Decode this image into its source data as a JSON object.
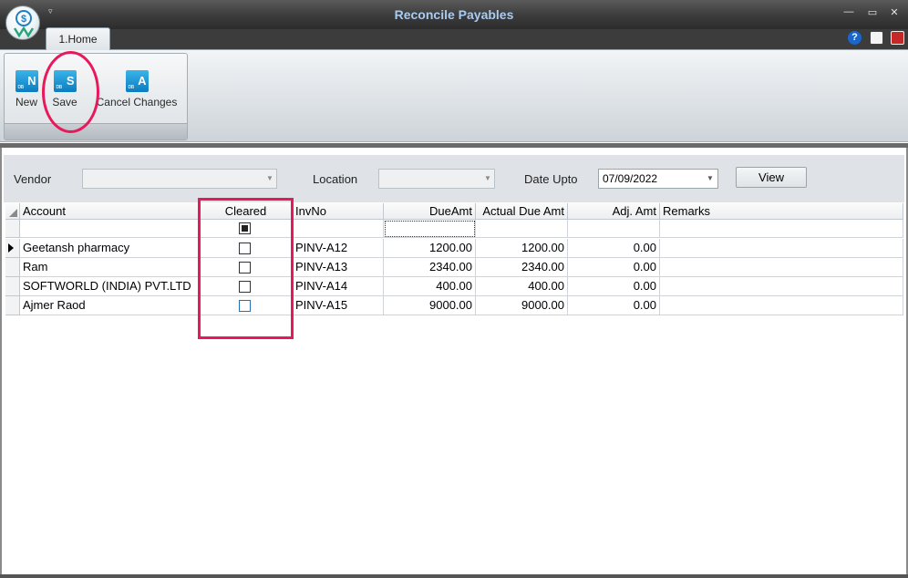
{
  "window": {
    "title": "Reconcile Payables",
    "qat_glyph": "▿",
    "minimize_glyph": "—",
    "maximize_glyph": "▭",
    "close_glyph": "✕"
  },
  "ribbon": {
    "tab_label": "1.Home",
    "buttons": {
      "new": {
        "label": "New",
        "icon_letter": "N"
      },
      "save": {
        "label": "Save",
        "icon_letter": "S"
      },
      "cancel": {
        "label": "Cancel Changes",
        "icon_letter": "A"
      }
    },
    "help_icon": "?"
  },
  "filters": {
    "vendor_label": "Vendor",
    "vendor_value": "",
    "location_label": "Location",
    "location_value": "",
    "date_label": "Date Upto",
    "date_value": "07/09/2022",
    "view_label": "View"
  },
  "grid": {
    "columns": {
      "account": "Account",
      "cleared": "Cleared",
      "invno": "InvNo",
      "dueamt": "DueAmt",
      "actual": "Actual Due Amt",
      "adj": "Adj. Amt",
      "remarks": "Remarks"
    },
    "rows": [
      {
        "account": "Geetansh pharmacy",
        "cleared": false,
        "invno": "PINV-A12",
        "dueamt": "1200.00",
        "actual": "1200.00",
        "adj": "0.00",
        "remarks": ""
      },
      {
        "account": "Ram",
        "cleared": false,
        "invno": "PINV-A13",
        "dueamt": "2340.00",
        "actual": "2340.00",
        "adj": "0.00",
        "remarks": ""
      },
      {
        "account": "SOFTWORLD (INDIA) PVT.LTD",
        "cleared": false,
        "invno": "PINV-A14",
        "dueamt": "400.00",
        "actual": "400.00",
        "adj": "0.00",
        "remarks": ""
      },
      {
        "account": "Ajmer Raod",
        "cleared": false,
        "invno": "PINV-A15",
        "dueamt": "9000.00",
        "actual": "9000.00",
        "adj": "0.00",
        "remarks": ""
      }
    ]
  },
  "colors": {
    "title_text": "#aacbf0",
    "annotation": "#e8195a",
    "ribbon_icon": "#1a8fd2"
  }
}
